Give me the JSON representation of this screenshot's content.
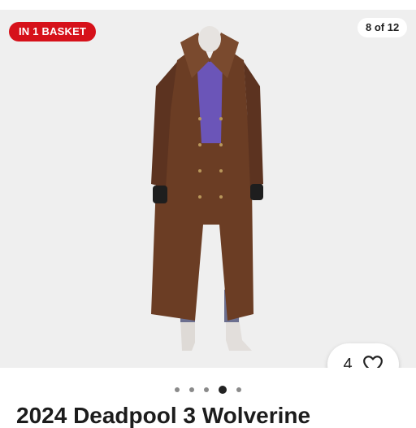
{
  "badge": {
    "label": "IN 1 BASKET"
  },
  "gallery": {
    "counter": "8 of 12",
    "current_index": 4,
    "total_dots": 5
  },
  "favorites": {
    "count": "4",
    "icon": "heart-outline-icon"
  },
  "product": {
    "title": "2024 Deadpool 3 Wolverine"
  },
  "colors": {
    "badge_bg": "#d6111a",
    "gallery_bg": "#efefef",
    "coat": "#6b3d24",
    "dot_active": "#222222",
    "dot_inactive": "#8a8a8a"
  }
}
